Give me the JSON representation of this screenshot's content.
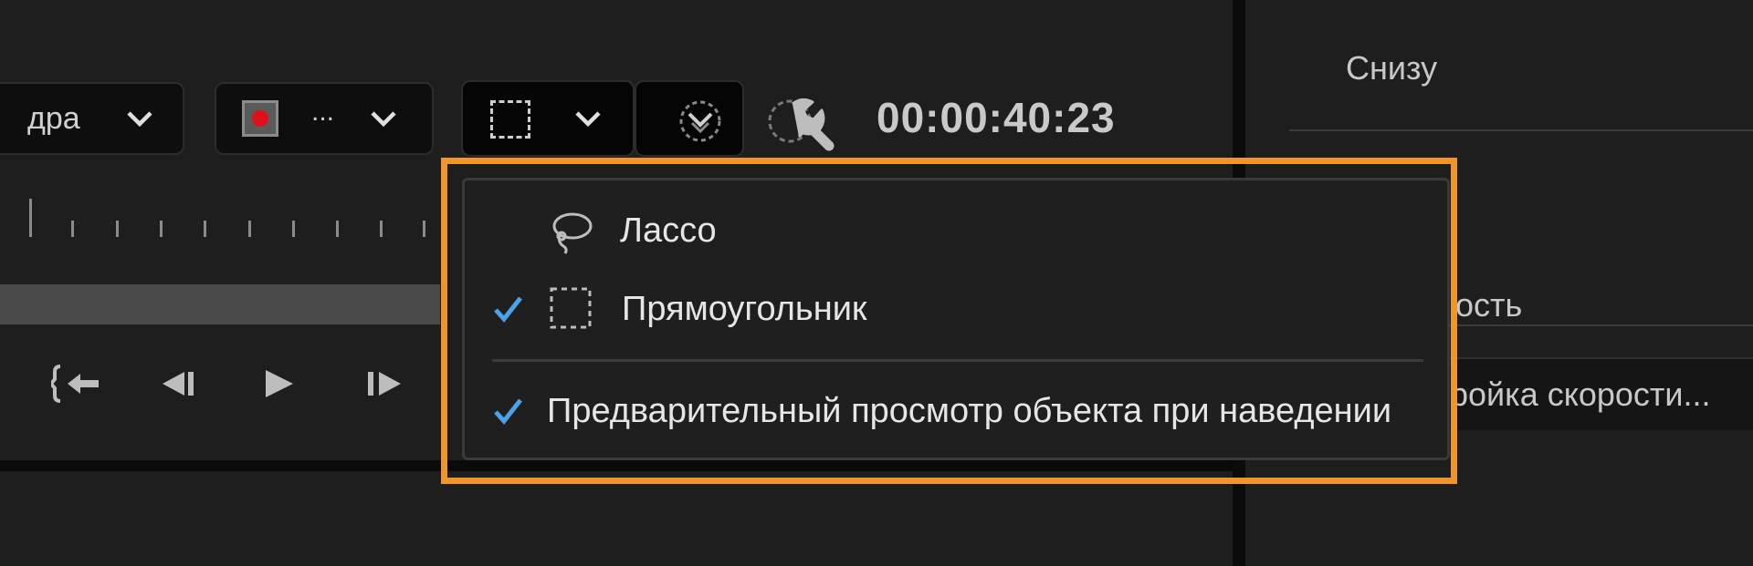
{
  "toolbar": {
    "frame_dropdown_label": "дра",
    "record_dropdown_label": "...",
    "timecode": "00:00:40:23"
  },
  "right_panel": {
    "bottom_label": "Снизу",
    "speed_label_partial": "ость",
    "speed_button_label": "ройка скорости..."
  },
  "selection_menu": {
    "items": [
      {
        "label": "Лассо",
        "checked": false,
        "icon": "lasso-icon"
      },
      {
        "label": "Прямоугольник",
        "checked": true,
        "icon": "rectangle-selection-icon"
      },
      {
        "label": "Предварительный просмотр объекта при наведении",
        "checked": true,
        "icon": ""
      }
    ]
  },
  "colors": {
    "accent_highlight": "#f0952a",
    "check_blue": "#4aa3e8",
    "record_red": "#e0101a"
  }
}
